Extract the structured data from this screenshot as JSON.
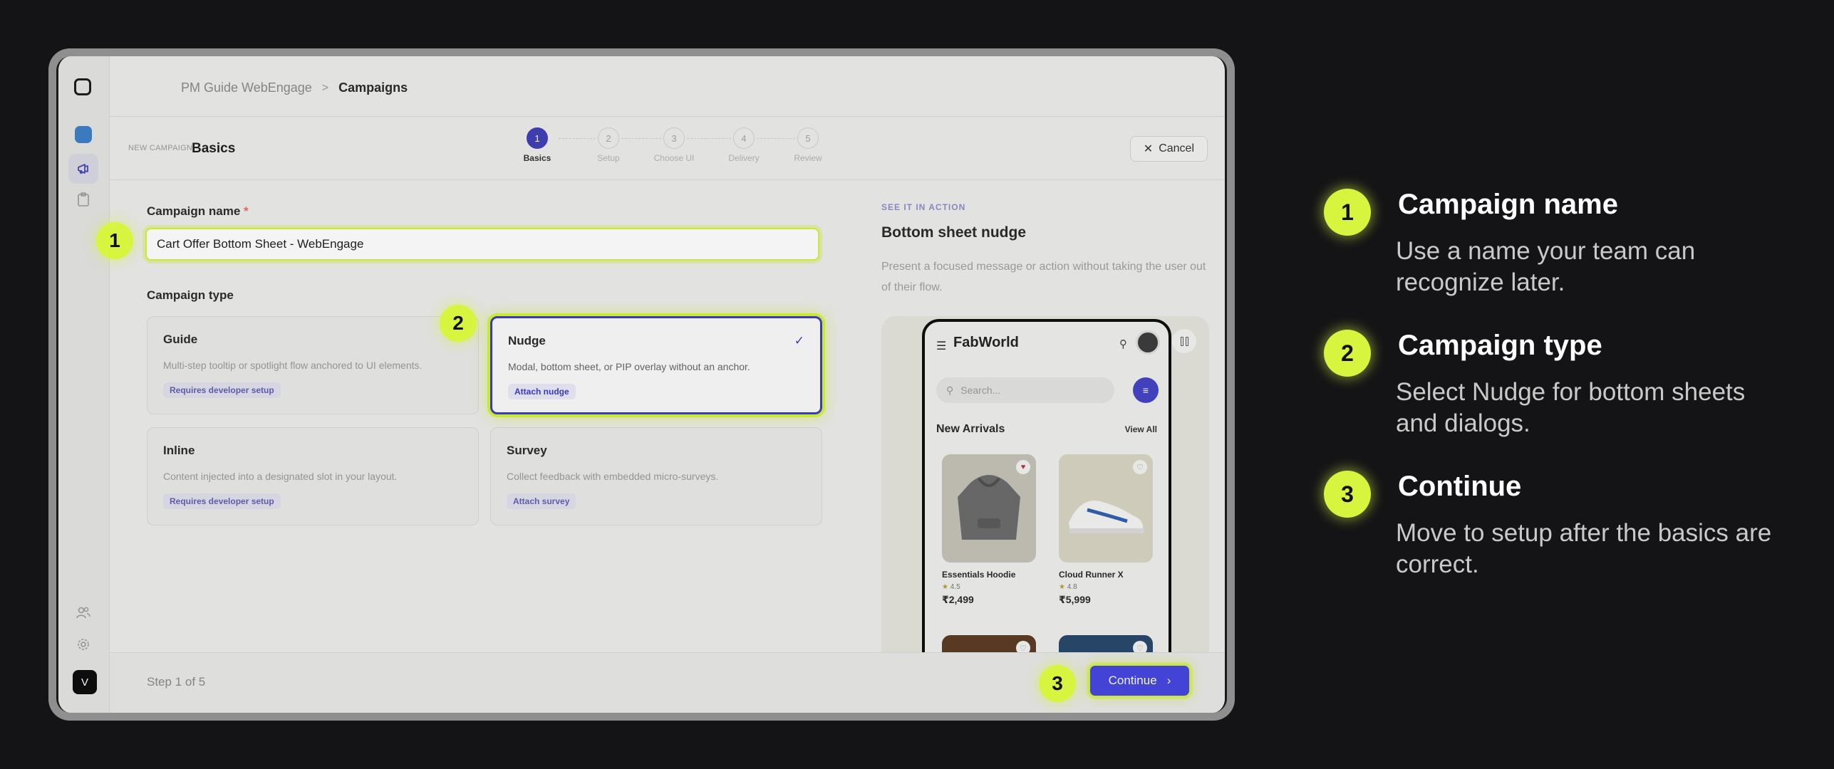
{
  "app": {
    "breadcrumb": [
      "PM Guide WebEngage",
      "Campaigns"
    ],
    "breadcrumb_sep": ">",
    "new_campaign_label": "NEW CAMPAIGN",
    "page_title": "Basics",
    "cancel_label": "Cancel",
    "avatar_initial": "V"
  },
  "stepper": [
    {
      "num": "1",
      "label": "Basics",
      "active": true
    },
    {
      "num": "2",
      "label": "Setup",
      "active": false
    },
    {
      "num": "3",
      "label": "Choose UI",
      "active": false
    },
    {
      "num": "4",
      "label": "Delivery",
      "active": false
    },
    {
      "num": "5",
      "label": "Review",
      "active": false
    }
  ],
  "form": {
    "name_label": "Campaign name",
    "required_mark": "*",
    "name_value": "Cart Offer Bottom Sheet - WebEngage",
    "type_label": "Campaign type",
    "types": [
      {
        "title": "Guide",
        "desc": "Multi-step tooltip or spotlight flow anchored to UI elements.",
        "badge": "Requires developer setup",
        "selected": false
      },
      {
        "title": "Nudge",
        "desc": "Modal, bottom sheet, or PIP overlay without an anchor.",
        "badge": "Attach nudge",
        "selected": true
      },
      {
        "title": "Inline",
        "desc": "Content injected into a designated slot in your layout.",
        "badge": "Requires developer setup",
        "selected": false
      },
      {
        "title": "Survey",
        "desc": "Collect feedback with embedded micro-surveys.",
        "badge": "Attach survey",
        "selected": false
      }
    ]
  },
  "preview": {
    "kicker": "SEE IT IN ACTION",
    "title": "Bottom sheet nudge",
    "desc": "Present a focused message or action without taking the user out of their flow.",
    "phone": {
      "brand": "FabWorld",
      "search_placeholder": "Search...",
      "section_title": "New Arrivals",
      "view_all": "View All",
      "products": [
        {
          "name": "Essentials Hoodie",
          "rating": "4.5",
          "price": "₹2,499",
          "color": "#b9b6ad",
          "favorited": true
        },
        {
          "name": "Cloud Runner X",
          "rating": "4.8",
          "price": "₹5,999",
          "color": "#d9d6c4",
          "favorited": false
        }
      ]
    }
  },
  "footer": {
    "step_text": "Step 1 of 5",
    "continue_label": "Continue"
  },
  "markers": [
    "1",
    "2",
    "3"
  ],
  "annotations": [
    {
      "num": "1",
      "title": "Campaign name",
      "desc": "Use a name your team can recognize later."
    },
    {
      "num": "2",
      "title": "Campaign type",
      "desc": "Select Nudge for bottom sheets and dialogs."
    },
    {
      "num": "3",
      "title": "Continue",
      "desc": "Move to setup after the basics are correct."
    }
  ],
  "colors": {
    "background": "#141416",
    "accent_primary": "#4545e0",
    "highlight_lime": "#d7f53e"
  }
}
